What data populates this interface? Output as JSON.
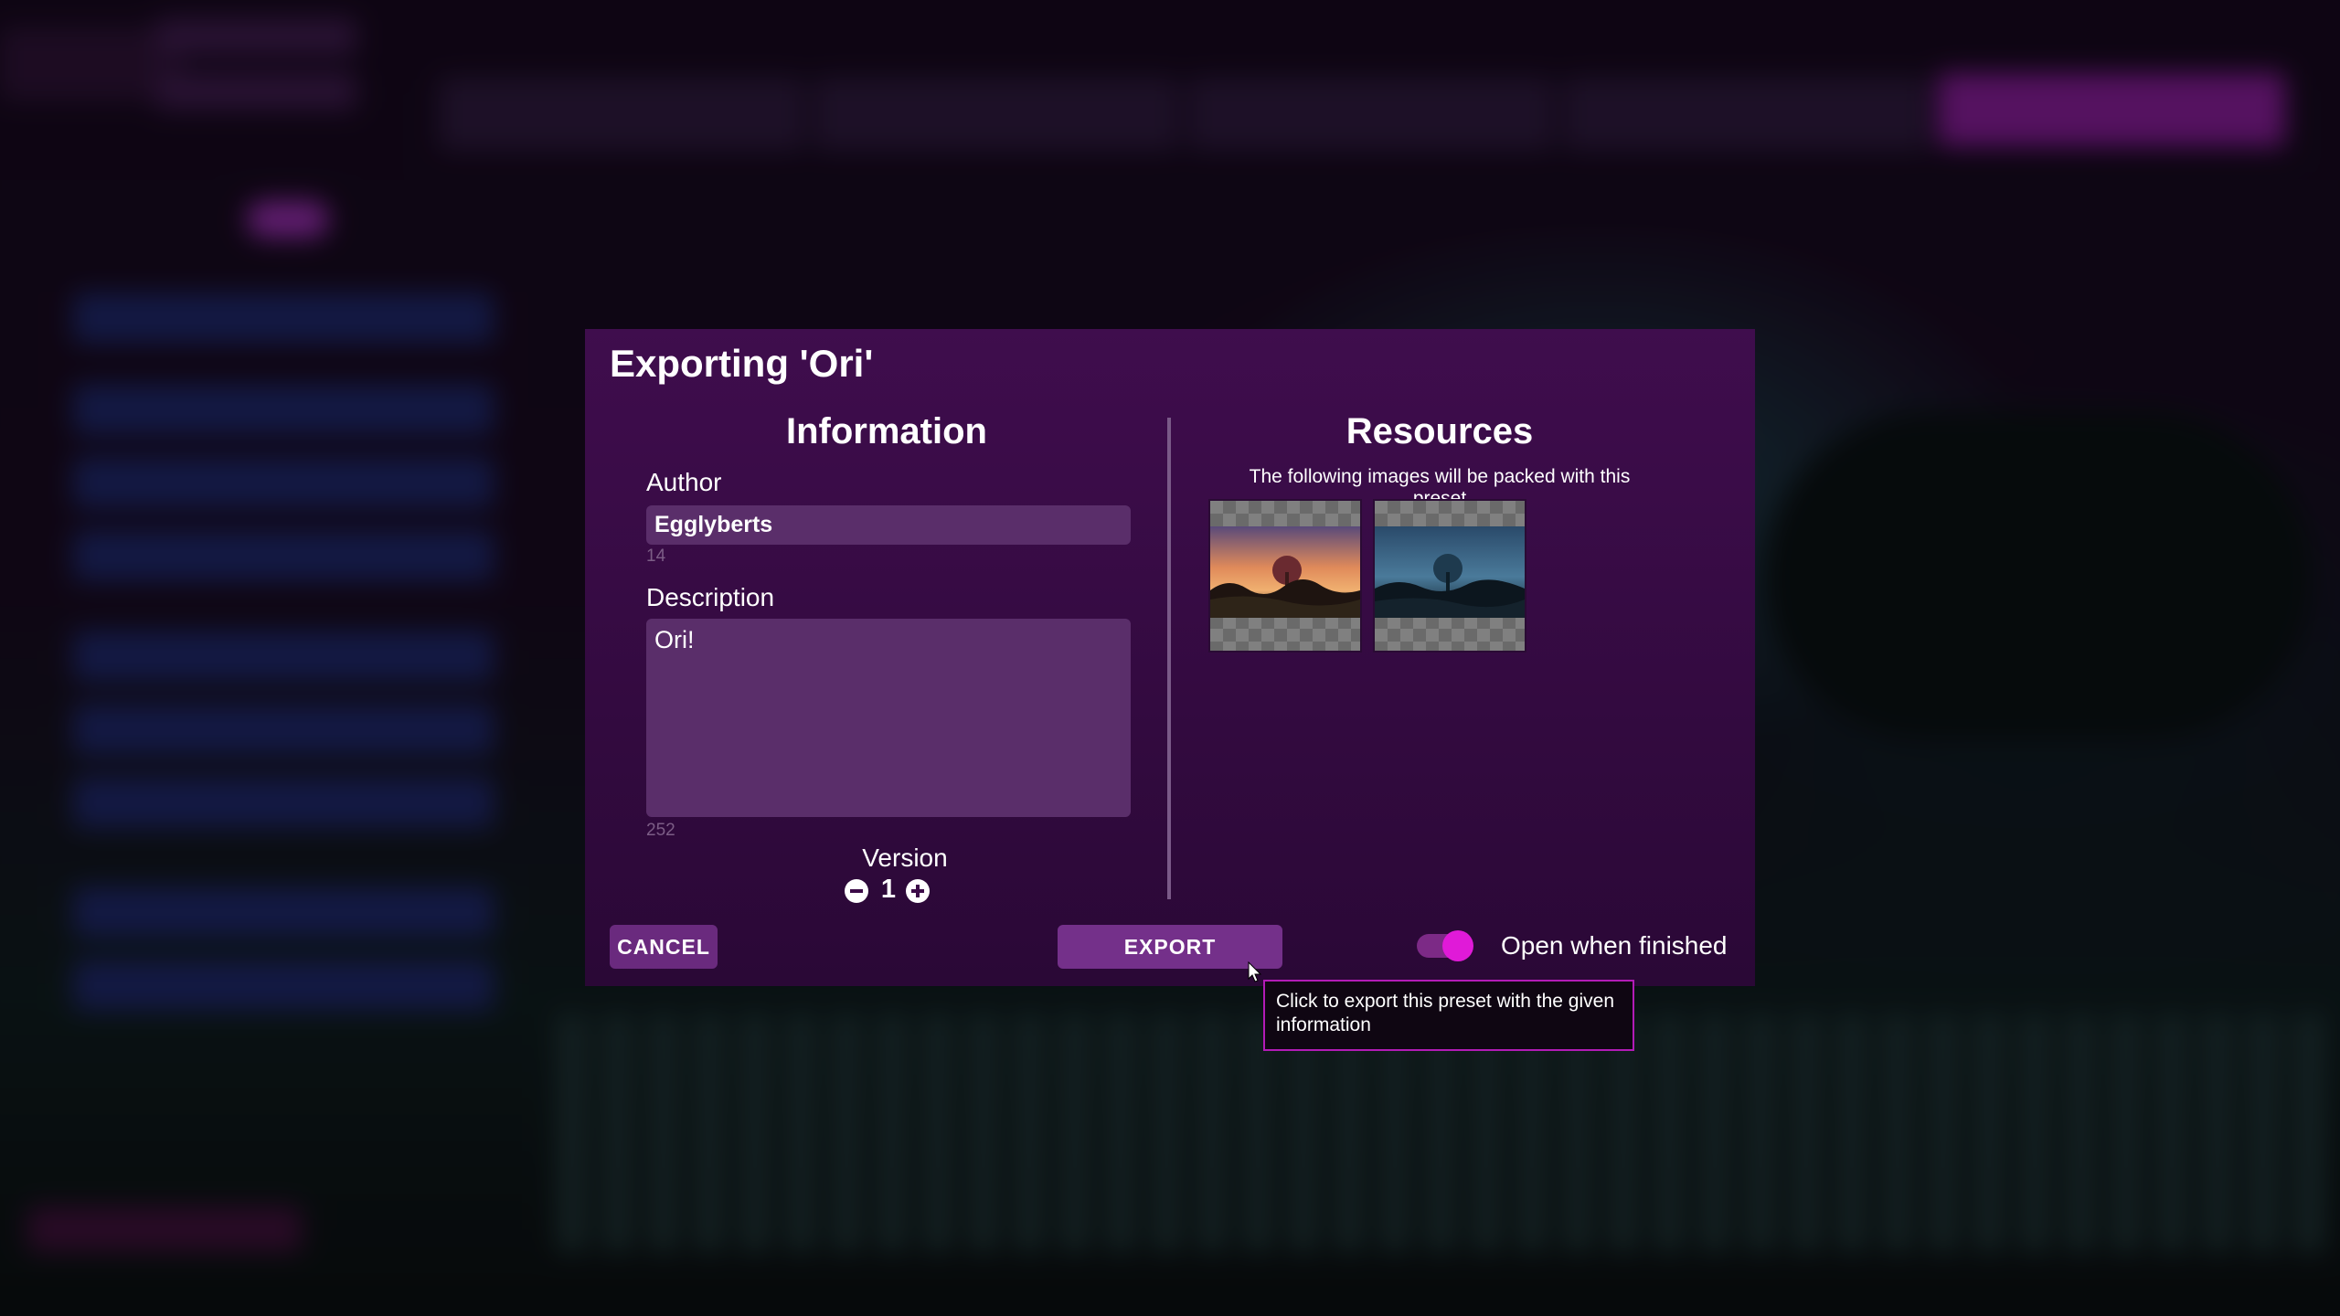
{
  "dialog": {
    "title": "Exporting 'Ori'",
    "information": {
      "title": "Information",
      "author_label": "Author",
      "author_value": "Egglyberts",
      "author_counter": "14",
      "description_label": "Description",
      "description_value": "Ori!",
      "description_counter": "252",
      "version_label": "Version",
      "version_value": "1",
      "minus_icon": "minus-icon",
      "plus_icon": "plus-icon"
    },
    "resources": {
      "title": "Resources",
      "caption": "The following images will be packed with this preset",
      "images": [
        {
          "name": "sunset-forest-image"
        },
        {
          "name": "night-forest-image"
        }
      ]
    },
    "actions": {
      "cancel_label": "CANCEL",
      "export_label": "EXPORT",
      "open_when_finished_label": "Open when finished",
      "open_when_finished_on": true
    },
    "tooltip": "Click to export this preset with the given information"
  },
  "colors": {
    "accent": "#e01ad8",
    "dialog_bg": "#3f0d4d",
    "field_bg": "#5a2e6a"
  }
}
